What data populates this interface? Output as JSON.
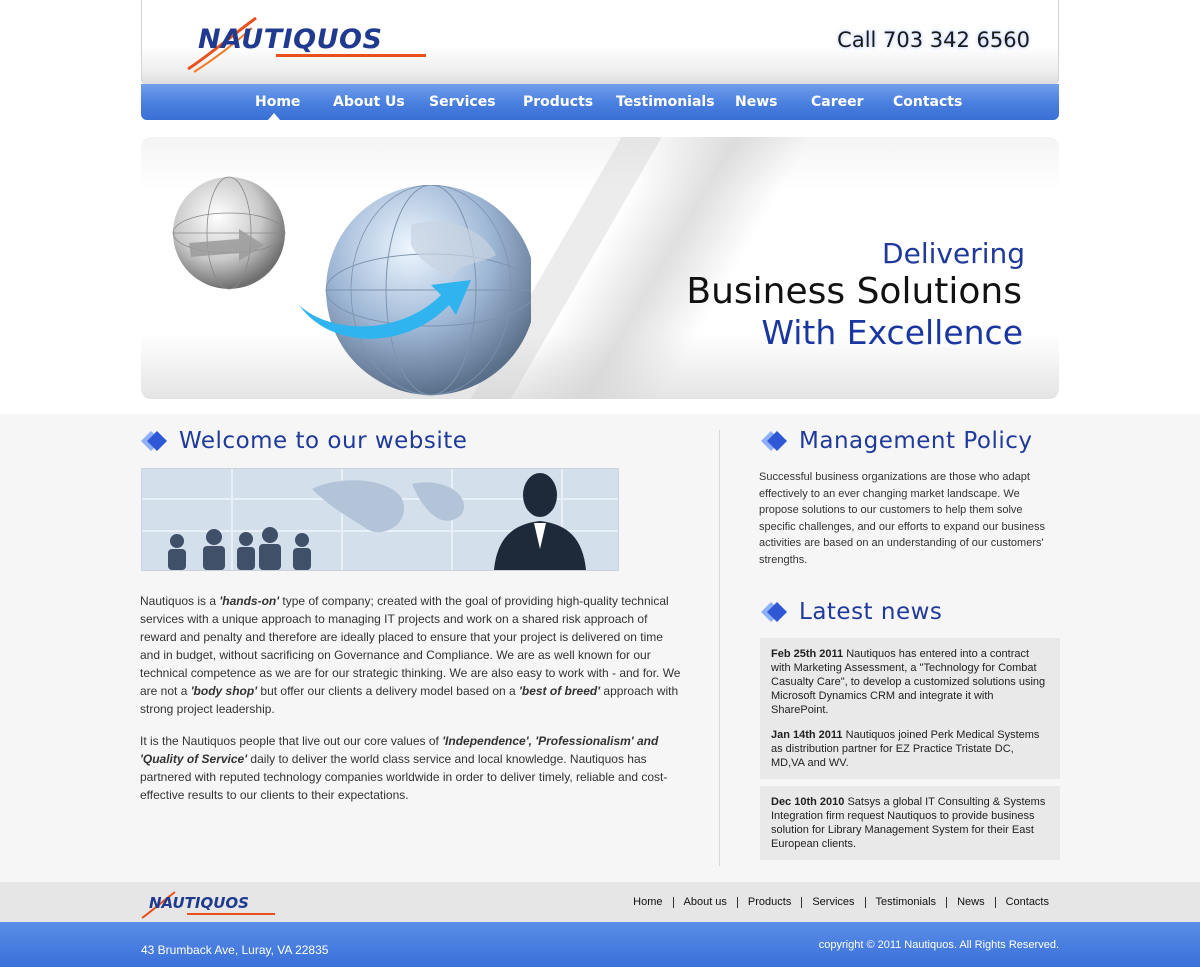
{
  "brand": {
    "logo_text": "NAUTIQUOS",
    "phone": "Call 703 342 6560"
  },
  "nav": {
    "items": [
      {
        "label": "Home",
        "active": true
      },
      {
        "label": "About Us"
      },
      {
        "label": "Services"
      },
      {
        "label": "Products"
      },
      {
        "label": "Testimonials"
      },
      {
        "label": "News"
      },
      {
        "label": "Career"
      },
      {
        "label": "Contacts"
      }
    ]
  },
  "banner": {
    "line1": "Delivering",
    "line2": "Business Solutions",
    "line3": "With Excellence"
  },
  "welcome": {
    "title": "Welcome to our website",
    "p1_a": "Nautiquos is a ",
    "p1_b": "'hands-on'",
    "p1_c": " type of company; created with the goal of providing high-quality technical services with a unique approach to managing IT projects and work on a shared risk approach of reward and penalty and therefore are ideally placed to ensure that your project is delivered on time and in budget, without sacrificing on Governance and Compliance. We are as well known for our technical competence as we are for our strategic thinking. We are also easy to work with - and for. We are not a ",
    "p1_d": "'body shop'",
    "p1_e": " but offer our clients a delivery model based on a ",
    "p1_f": "'best of breed'",
    "p1_g": " approach with strong project leadership.",
    "p2_a": "It is the Nautiquos people that live out our core values of ",
    "p2_b": "'Independence', 'Professionalism' and 'Quality of Service'",
    "p2_c": " daily to deliver the world class service and local knowledge. Nautiquos has partnered with reputed technology companies worldwide in order to deliver timely, reliable and cost-effective results to our clients to their expectations."
  },
  "management": {
    "title": "Management Policy",
    "text": "Successful business organizations are those who adapt effectively to an ever changing market landscape. We propose solutions to our customers to help them solve specific challenges, and our efforts to expand our business activities are based on an understanding of our customers' strengths."
  },
  "news": {
    "title": "Latest news",
    "items": [
      {
        "date": "Feb 25th 2011",
        "text": " Nautiquos has entered into a contract with Marketing Assessment, a \"Technology for Combat Casualty Care\", to develop a customized solutions using Microsoft Dynamics CRM and integrate it with SharePoint."
      },
      {
        "date": "Jan 14th 2011",
        "text": " Nautiquos joined Perk Medical Systems as distribution partner for EZ Practice Tristate DC, MD,VA and WV."
      },
      {
        "date": "Dec 10th 2010",
        "text": " Satsys a global IT Consulting & Systems Integration firm request Nautiquos to provide business solution for Library Management System for their East European clients."
      }
    ]
  },
  "footer": {
    "logo_text": "NAUTIQUOS",
    "links": [
      "Home",
      "About us",
      "Products",
      "Services",
      "Testimonials",
      "News",
      "Contacts"
    ],
    "address": "43 Brumback Ave, Luray, VA 22835",
    "copyright": "copyright © 2011 Nautiquos. All Rights Reserved."
  },
  "colors": {
    "brand_blue": "#1f3a9a",
    "nav_blue": "#4a7fe0",
    "accent_orange": "#e8511c"
  }
}
